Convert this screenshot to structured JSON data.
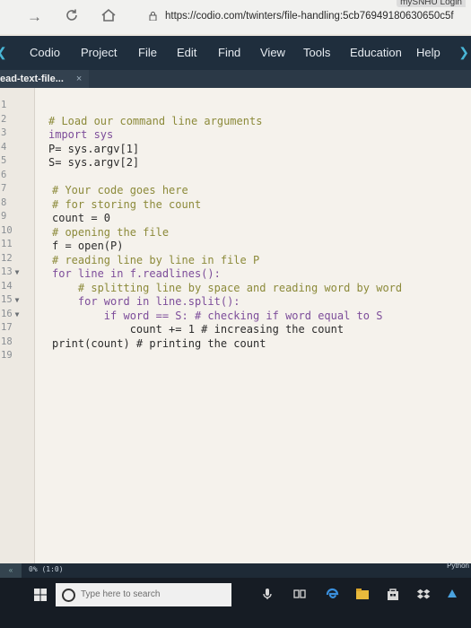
{
  "browser": {
    "login_label": "mySNHU Login",
    "url": "https://codio.com/twinters/file-handling:5cb76949180630650c5f"
  },
  "menu": {
    "items": [
      "Codio",
      "Project",
      "File",
      "Edit",
      "Find",
      "View",
      "Tools",
      "Education",
      "Help"
    ]
  },
  "tab": {
    "label": "ead-text-file...",
    "close": "×"
  },
  "editor": {
    "line_numbers": [
      "1",
      "2",
      "3",
      "4",
      "5",
      "6",
      "7",
      "8",
      "9",
      "10",
      "11",
      "12",
      "13",
      "14",
      "15",
      "16",
      "17",
      "18",
      "19"
    ],
    "lines": [
      "",
      "# Load our command line arguments",
      "import sys",
      "P= sys.argv[1]",
      "S= sys.argv[2]",
      "",
      "# Your code goes here",
      "# for storing the count",
      "count = 0",
      "# opening the file",
      "f = open(P)",
      "# reading line by line in file P",
      "for line in f.readlines():",
      "    # splitting line by space and reading word by word",
      "    for word in line.split():",
      "        if word == S: # checking if word equal to S",
      "            count += 1 # increasing the count",
      "print(count) # printing the count",
      ""
    ]
  },
  "status": {
    "position": "0%  (1:0)",
    "language": "Python",
    "scroll": "«"
  },
  "taskbar": {
    "search_placeholder": "Type here to search"
  },
  "colors": {
    "menu_bg": "#1f2e3d",
    "accent": "#49b6d6",
    "editor_bg": "#f5f2ec",
    "comment": "#8c8a3a",
    "keyword": "#7d4d9a"
  }
}
